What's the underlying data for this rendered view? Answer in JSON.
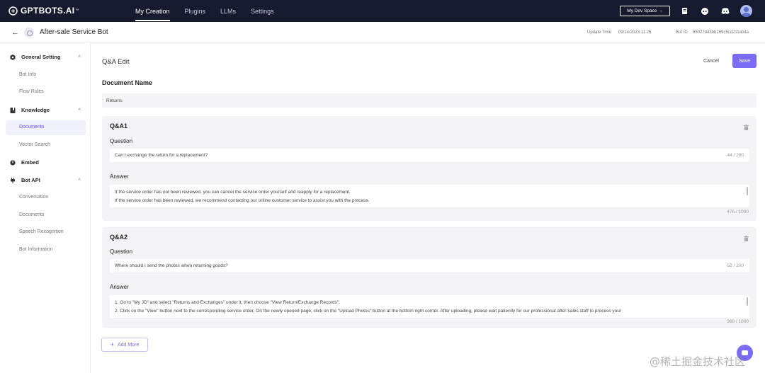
{
  "topbar": {
    "logo": "GPTBOTS.AI",
    "logo_tm": "™",
    "nav": [
      "My Creation",
      "Plugins",
      "LLMs",
      "Settings"
    ],
    "dev_space": "My Dev Space →",
    "icons": [
      "document-icon",
      "bot-icon",
      "discord-icon",
      "avatar"
    ]
  },
  "header": {
    "back": "←",
    "bot_name": "After-sale Service Bot",
    "update_label": "Update Time",
    "update_value": "09/14/2023 11:25",
    "botid_label": "Bot ID",
    "botid_value": "65027d43bb269c5cd211ab4a"
  },
  "sidebar": {
    "sections": [
      {
        "label": "General Setting",
        "chevron": "^",
        "icon": "gear-icon",
        "items": [
          "Bot Info",
          "Flow Rules"
        ]
      },
      {
        "label": "Knowledge",
        "chevron": "^",
        "icon": "book-icon",
        "items": [
          "Documents",
          "Vector Search"
        ]
      },
      {
        "label": "Embed",
        "icon": "embed-icon",
        "items": []
      },
      {
        "label": "Bot API",
        "chevron": "^",
        "icon": "plug-icon",
        "items": [
          "Conversation",
          "Documents",
          "Speech Recognition",
          "Bot Information"
        ]
      }
    ],
    "active": "Documents"
  },
  "main": {
    "title": "Q&A Edit",
    "cancel": "Cancel",
    "save": "Save",
    "doc_name_label": "Document Name",
    "doc_name_value": "Returns",
    "question_label": "Question",
    "answer_label": "Answer",
    "qas": [
      {
        "title": "Q&A1",
        "question": "Can I exchange the return for a replacement?",
        "question_count": "44 / 200",
        "answer_line1": "If the service order has not been reviewed, you can cancel the service order yourself and reapply for a replacement.",
        "answer_line2": "If the service order has been reviewed, we recommend contacting our online customer service to assist you with the process.",
        "answer_count": "476 / 1000"
      },
      {
        "title": "Q&A2",
        "question": "Where should I send the photos when returning goods?",
        "question_count": "52 / 200",
        "answer_line1": "1. Go to \"My JD\" and select \"Returns and Exchanges\" under it, then choose \"View Return/Exchange Records\".",
        "answer_line2": "2. Click on the \"View\" button next to the corresponding service order. On the newly opened page, click on the \"Upload Photos\" button at the bottom right corner. After uploading, please wait patiently for our professional after-sales staff to process your",
        "answer_count": "369 / 1000"
      }
    ],
    "add_more": "Add More"
  },
  "watermark": "@稀土掘金技术社区",
  "colors": {
    "accent": "#7b6cf5",
    "topbar": "#151a2e"
  }
}
